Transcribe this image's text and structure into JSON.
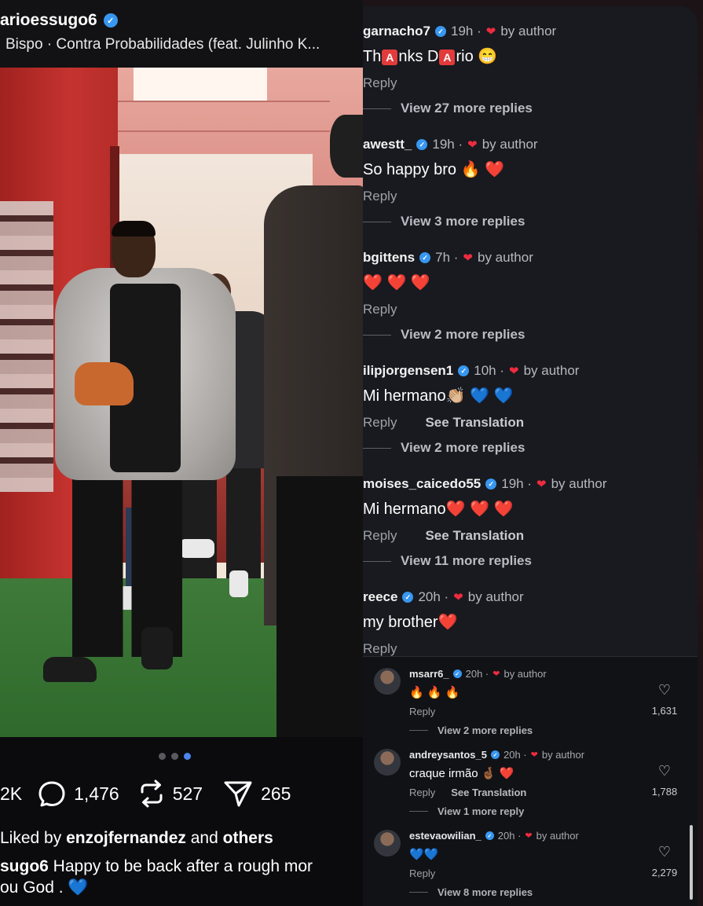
{
  "post": {
    "username": "arioessugo6",
    "song": "Bispo · Contra Probabilidades (feat. Julinho K...",
    "likes_count": "2K",
    "comments_count": "1,476",
    "reposts_count": "527",
    "shares_count": "265",
    "liked_by_prefix": "Liked by ",
    "liked_by_user": "enzojfernandez",
    "liked_by_mid": " and ",
    "liked_by_others": "others",
    "caption_user": "sugo6",
    "caption_text": " Happy to be back after a rough mor",
    "caption_line2": "ou God . 💙",
    "carousel_active_index": 3
  },
  "comments": [
    {
      "user": "garnacho7",
      "time": "19h ·",
      "by": "by author",
      "text_parts": [
        "Th",
        "A",
        "nks D",
        "A",
        "rio 😁"
      ],
      "reply": "Reply",
      "more": "View 27 more replies"
    },
    {
      "user": "awestt_",
      "time": "19h ·",
      "by": "by author",
      "text": "So happy bro 🔥 ❤️",
      "reply": "Reply",
      "more": "View 3 more replies"
    },
    {
      "user": "bgittens",
      "time": "7h ·",
      "by": "by author",
      "text": "❤️ ❤️ ❤️",
      "reply": "Reply",
      "more": "View 2 more replies"
    },
    {
      "user": "ilipjorgensen1",
      "time": "10h ·",
      "by": "by author",
      "text": "Mi hermano👏🏼 💙 💙",
      "reply": "Reply",
      "see": "See Translation",
      "more": "View 2 more replies"
    },
    {
      "user": "moises_caicedo55",
      "time": "19h ·",
      "by": "by author",
      "text": "Mi hermano❤️ ❤️ ❤️",
      "reply": "Reply",
      "see": "See Translation",
      "more": "View 11 more replies"
    },
    {
      "user": "reece",
      "time": "20h ·",
      "by": "by author",
      "text": "my brother❤️",
      "reply": "Reply"
    }
  ],
  "sub_comments": [
    {
      "user": "msarr6_",
      "time": "20h ·",
      "by": "by author",
      "text": "🔥 🔥 🔥",
      "reply": "Reply",
      "more": "View 2 more replies",
      "likes": "1,631"
    },
    {
      "user": "andreysantos_5",
      "time": "20h ·",
      "by": "by author",
      "text": "craque irmão 🤞🏾 ❤️",
      "reply": "Reply",
      "see": "See Translation",
      "more": "View 1 more reply",
      "likes": "1,788"
    },
    {
      "user": "estevaowilian_",
      "time": "20h ·",
      "by": "by author",
      "text": "💙💙",
      "reply": "Reply",
      "more": "View 8 more replies",
      "likes": "2,279"
    }
  ],
  "icons": {
    "verified": "verified-badge-icon",
    "heart": "heart-icon",
    "comment": "comment-icon",
    "repost": "repost-icon",
    "share": "share-icon"
  },
  "colors": {
    "accent_blue": "#3897f0",
    "heart_red": "#ef2b3f",
    "panel_bg": "#181a1f"
  }
}
